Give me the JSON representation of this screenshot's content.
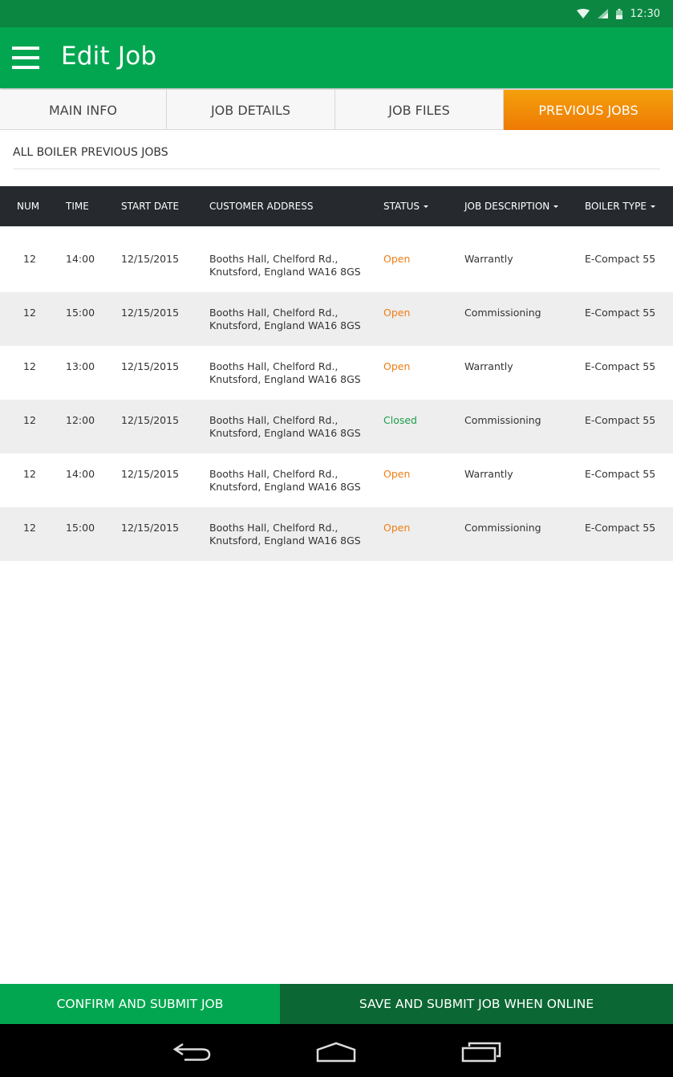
{
  "status_bar": {
    "time": "12:30",
    "icons": [
      "wifi-icon",
      "signal-icon",
      "battery-icon"
    ]
  },
  "app_bar": {
    "menu_icon": "hamburger-menu-icon",
    "title": "Edit Job"
  },
  "tabs": [
    {
      "label": "MAIN INFO",
      "active": false
    },
    {
      "label": "JOB DETAILS",
      "active": false
    },
    {
      "label": "JOB FILES",
      "active": false
    },
    {
      "label": "PREVIOUS JOBS",
      "active": true
    }
  ],
  "section": {
    "title": "ALL BOILER PREVIOUS JOBS"
  },
  "table": {
    "columns": [
      {
        "label": "NUM",
        "sortable": false
      },
      {
        "label": "TIME",
        "sortable": false
      },
      {
        "label": "START DATE",
        "sortable": false
      },
      {
        "label": "CUSTOMER ADDRESS",
        "sortable": false
      },
      {
        "label": "STATUS",
        "sortable": true
      },
      {
        "label": "JOB DESCRIPTION",
        "sortable": true
      },
      {
        "label": "BOILER TYPE",
        "sortable": true
      }
    ],
    "rows": [
      {
        "num": "12",
        "time": "14:00",
        "start_date": "12/15/2015",
        "address_line1": "Booths Hall, Chelford Rd.,",
        "address_line2": "Knutsford, England WA16 8GS",
        "status": "Open",
        "description": "Warrantly",
        "boiler_type": "E-Compact 55"
      },
      {
        "num": "12",
        "time": "15:00",
        "start_date": "12/15/2015",
        "address_line1": "Booths Hall, Chelford Rd.,",
        "address_line2": "Knutsford, England WA16 8GS",
        "status": "Open",
        "description": "Commissioning",
        "boiler_type": "E-Compact 55"
      },
      {
        "num": "12",
        "time": "13:00",
        "start_date": "12/15/2015",
        "address_line1": "Booths Hall, Chelford Rd.,",
        "address_line2": "Knutsford, England WA16 8GS",
        "status": "Open",
        "description": "Warrantly",
        "boiler_type": "E-Compact 55"
      },
      {
        "num": "12",
        "time": "12:00",
        "start_date": "12/15/2015",
        "address_line1": "Booths Hall, Chelford Rd.,",
        "address_line2": "Knutsford, England WA16 8GS",
        "status": "Closed",
        "description": "Commissioning",
        "boiler_type": "E-Compact 55"
      },
      {
        "num": "12",
        "time": "14:00",
        "start_date": "12/15/2015",
        "address_line1": "Booths Hall, Chelford Rd.,",
        "address_line2": "Knutsford, England WA16 8GS",
        "status": "Open",
        "description": "Warrantly",
        "boiler_type": "E-Compact 55"
      },
      {
        "num": "12",
        "time": "15:00",
        "start_date": "12/15/2015",
        "address_line1": "Booths Hall, Chelford Rd.,",
        "address_line2": "Knutsford, England WA16 8GS",
        "status": "Open",
        "description": "Commissioning",
        "boiler_type": "E-Compact 55"
      }
    ]
  },
  "actions": {
    "confirm_label": "CONFIRM AND SUBMIT JOB",
    "save_label": "SAVE AND SUBMIT JOB WHEN ONLINE"
  },
  "nav_bar": {
    "icons": [
      "back-icon",
      "home-icon",
      "recent-apps-icon"
    ]
  },
  "colors": {
    "primary_green": "#03a650",
    "dark_green": "#0b6733",
    "status_bar_green": "#0b8742",
    "tab_active_orange": "#ee7a05",
    "status_open": "#f07d14",
    "status_closed": "#1f9a49",
    "table_header": "#262a2f"
  }
}
